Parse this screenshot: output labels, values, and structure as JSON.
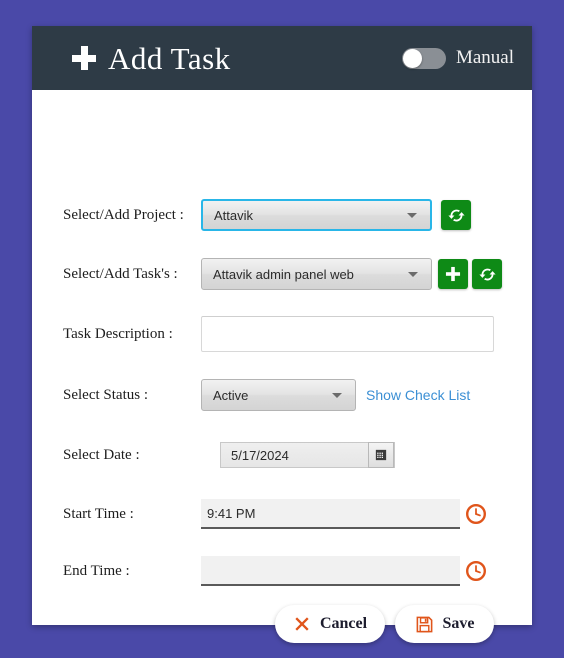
{
  "header": {
    "title": "Add Task",
    "plus_icon": "plus-icon",
    "toggle_label": "Manual",
    "toggle_state": "off"
  },
  "form": {
    "project": {
      "label": "Select/Add Project :",
      "value": "Attavik",
      "refresh_icon": "refresh-icon"
    },
    "task": {
      "label": "Select/Add Task's :",
      "value": "Attavik admin panel web",
      "add_icon": "plus-icon",
      "refresh_icon": "refresh-icon"
    },
    "description": {
      "label": "Task Description :",
      "value": "",
      "placeholder": ""
    },
    "status": {
      "label": "Select Status :",
      "value": "Active",
      "check_list_link": "Show Check List"
    },
    "date": {
      "label": "Select Date :",
      "value": "5/17/2024",
      "calendar_icon": "calendar-icon"
    },
    "start_time": {
      "label": "Start Time :",
      "value": "9:41 PM",
      "clock_icon": "clock-icon"
    },
    "end_time": {
      "label": "End Time :",
      "value": "",
      "clock_icon": "clock-icon"
    }
  },
  "footer": {
    "cancel_label": "Cancel",
    "cancel_icon": "close-x-icon",
    "save_label": "Save",
    "save_icon": "floppy-disk-icon"
  },
  "colors": {
    "page_background": "#4a49a8",
    "header_background": "#2e3b46",
    "green_button": "#0e8a16",
    "orange_icon": "#e0551b",
    "link_blue": "#3b8fd4",
    "focus_border": "#29b6e8"
  }
}
